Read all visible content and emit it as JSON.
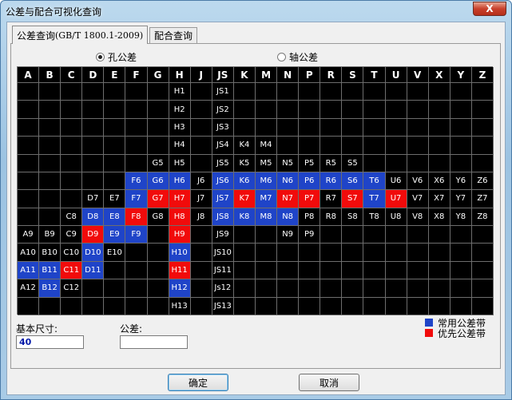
{
  "window": {
    "title": "公差与配合可视化查询",
    "close": "X"
  },
  "tabs": [
    {
      "label": "公差查询",
      "suffix": "(GB/T 1800.1-2009)"
    },
    {
      "label": "配合查询",
      "suffix": ""
    }
  ],
  "radios": [
    {
      "label": "孔公差",
      "selected": true
    },
    {
      "label": "轴公差",
      "selected": false
    }
  ],
  "columns": [
    "A",
    "B",
    "C",
    "D",
    "E",
    "F",
    "G",
    "H",
    "J",
    "JS",
    "K",
    "M",
    "N",
    "P",
    "R",
    "S",
    "T",
    "U",
    "V",
    "X",
    "Y",
    "Z"
  ],
  "rows": [
    {
      "A": "",
      "B": "",
      "C": "",
      "D": "",
      "E": "",
      "F": "",
      "G": "",
      "H": "H1",
      "J": "",
      "JS": "JS1",
      "K": "",
      "M": "",
      "N": "",
      "P": "",
      "R": "",
      "S": "",
      "T": "",
      "U": "",
      "V": "",
      "X": "",
      "Y": "",
      "Z": ""
    },
    {
      "A": "",
      "B": "",
      "C": "",
      "D": "",
      "E": "",
      "F": "",
      "G": "",
      "H": "H2",
      "J": "",
      "JS": "JS2",
      "K": "",
      "M": "",
      "N": "",
      "P": "",
      "R": "",
      "S": "",
      "T": "",
      "U": "",
      "V": "",
      "X": "",
      "Y": "",
      "Z": ""
    },
    {
      "A": "",
      "B": "",
      "C": "",
      "D": "",
      "E": "",
      "F": "",
      "G": "",
      "H": "H3",
      "J": "",
      "JS": "JS3",
      "K": "",
      "M": "",
      "N": "",
      "P": "",
      "R": "",
      "S": "",
      "T": "",
      "U": "",
      "V": "",
      "X": "",
      "Y": "",
      "Z": ""
    },
    {
      "A": "",
      "B": "",
      "C": "",
      "D": "",
      "E": "",
      "F": "",
      "G": "",
      "H": "H4",
      "J": "",
      "JS": "JS4",
      "K": "K4",
      "M": "M4",
      "N": "",
      "P": "",
      "R": "",
      "S": "",
      "T": "",
      "U": "",
      "V": "",
      "X": "",
      "Y": "",
      "Z": ""
    },
    {
      "A": "",
      "B": "",
      "C": "",
      "D": "",
      "E": "",
      "F": "",
      "G": "G5",
      "H": "H5",
      "J": "",
      "JS": "JS5",
      "K": "K5",
      "M": "M5",
      "N": "N5",
      "P": "P5",
      "R": "R5",
      "S": "S5",
      "T": "",
      "U": "",
      "V": "",
      "X": "",
      "Y": "",
      "Z": ""
    },
    {
      "A": "",
      "B": "",
      "C": "",
      "D": "",
      "E": "",
      "F": "F6",
      "G": "G6",
      "H": "H6",
      "J": "J6",
      "JS": "JS6",
      "K": "K6",
      "M": "M6",
      "N": "N6",
      "P": "P6",
      "R": "R6",
      "S": "S6",
      "T": "T6",
      "U": "U6",
      "V": "V6",
      "X": "X6",
      "Y": "Y6",
      "Z": "Z6"
    },
    {
      "A": "",
      "B": "",
      "C": "",
      "D": "D7",
      "E": "E7",
      "F": "F7",
      "G": "G7",
      "H": "H7",
      "J": "J7",
      "JS": "JS7",
      "K": "K7",
      "M": "M7",
      "N": "N7",
      "P": "P7",
      "R": "R7",
      "S": "S7",
      "T": "T7",
      "U": "U7",
      "V": "V7",
      "X": "X7",
      "Y": "Y7",
      "Z": "Z7"
    },
    {
      "A": "",
      "B": "",
      "C": "C8",
      "D": "D8",
      "E": "E8",
      "F": "F8",
      "G": "G8",
      "H": "H8",
      "J": "J8",
      "JS": "JS8",
      "K": "K8",
      "M": "M8",
      "N": "N8",
      "P": "P8",
      "R": "R8",
      "S": "S8",
      "T": "T8",
      "U": "U8",
      "V": "V8",
      "X": "X8",
      "Y": "Y8",
      "Z": "Z8"
    },
    {
      "A": "A9",
      "B": "B9",
      "C": "C9",
      "D": "D9",
      "E": "E9",
      "F": "F9",
      "G": "",
      "H": "H9",
      "J": "",
      "JS": "JS9",
      "K": "",
      "M": "",
      "N": "N9",
      "P": "P9",
      "R": "",
      "S": "",
      "T": "",
      "U": "",
      "V": "",
      "X": "",
      "Y": "",
      "Z": ""
    },
    {
      "A": "A10",
      "B": "B10",
      "C": "C10",
      "D": "D10",
      "E": "E10",
      "F": "",
      "G": "",
      "H": "H10",
      "J": "",
      "JS": "JS10",
      "K": "",
      "M": "",
      "N": "",
      "P": "",
      "R": "",
      "S": "",
      "T": "",
      "U": "",
      "V": "",
      "X": "",
      "Y": "",
      "Z": ""
    },
    {
      "A": "A11",
      "B": "B11",
      "C": "C11",
      "D": "D11",
      "E": "",
      "F": "",
      "G": "",
      "H": "H11",
      "J": "",
      "JS": "JS11",
      "K": "",
      "M": "",
      "N": "",
      "P": "",
      "R": "",
      "S": "",
      "T": "",
      "U": "",
      "V": "",
      "X": "",
      "Y": "",
      "Z": ""
    },
    {
      "A": "A12",
      "B": "B12",
      "C": "C12",
      "D": "",
      "E": "",
      "F": "",
      "G": "",
      "H": "H12",
      "J": "",
      "JS": "Js12",
      "K": "",
      "M": "",
      "N": "",
      "P": "",
      "R": "",
      "S": "",
      "T": "",
      "U": "",
      "V": "",
      "X": "",
      "Y": "",
      "Z": ""
    },
    {
      "A": "",
      "B": "",
      "C": "",
      "D": "",
      "E": "",
      "F": "",
      "G": "",
      "H": "H13",
      "J": "",
      "JS": "JS13",
      "K": "",
      "M": "",
      "N": "",
      "P": "",
      "R": "",
      "S": "",
      "T": "",
      "U": "",
      "V": "",
      "X": "",
      "Y": "",
      "Z": ""
    }
  ],
  "common_band": [
    "F6",
    "G6",
    "H6",
    "JS6",
    "K6",
    "M6",
    "N6",
    "P6",
    "R6",
    "S6",
    "T6",
    "F7",
    "JS7",
    "K8",
    "M8",
    "N8",
    "D8",
    "E8",
    "E9",
    "F9",
    "D10",
    "A11",
    "B11",
    "D11",
    "H10",
    "H12",
    "B12",
    "M7",
    "T7",
    "H8",
    "JS8",
    "H6"
  ],
  "preferred_band": [
    "G7",
    "H7",
    "K7",
    "N7",
    "P7",
    "S7",
    "U7",
    "F8",
    "H8",
    "D9",
    "H9",
    "C11",
    "H11"
  ],
  "fields": {
    "basic_size_label": "基本尺寸:",
    "basic_size_value": "40",
    "tolerance_label": "公差:",
    "tolerance_value": ""
  },
  "legend": [
    {
      "label": "常用公差带",
      "color": "#1f44c8"
    },
    {
      "label": "优先公差带",
      "color": "#f10b0b"
    }
  ],
  "buttons": {
    "ok": "确定",
    "cancel": "取消"
  }
}
